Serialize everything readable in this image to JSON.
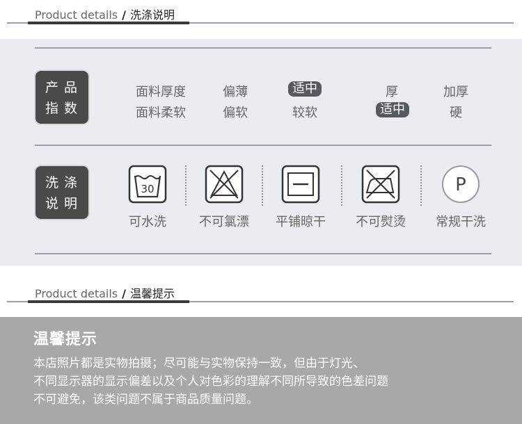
{
  "header1": {
    "en": "Product details",
    "sep": "/",
    "zh": "洗涤说明"
  },
  "header2": {
    "en": "Product details",
    "sep": "/",
    "zh": "温馨提示"
  },
  "product_index": {
    "badge": [
      "产品",
      "指数"
    ],
    "row1": {
      "label": "面料厚度",
      "options": [
        "偏薄",
        "适中",
        "厚",
        "加厚"
      ],
      "selected": "适中"
    },
    "row2": {
      "label": "面料柔软",
      "options": [
        "偏软",
        "较软",
        "适中",
        "硬"
      ],
      "selected": "适中"
    }
  },
  "wash_instructions": {
    "badge": [
      "洗涤",
      "说明"
    ],
    "items": [
      {
        "icon": "wash-30-icon",
        "label": "可水洗",
        "temp": "30"
      },
      {
        "icon": "no-bleach-icon",
        "label": "不可氯漂"
      },
      {
        "icon": "flat-dry-icon",
        "label": "平铺晾干"
      },
      {
        "icon": "no-iron-icon",
        "label": "不可熨烫"
      },
      {
        "icon": "dry-clean-p-icon",
        "label": "常规干洗",
        "letter": "P"
      }
    ]
  },
  "notice": {
    "title": "温馨提示",
    "lines": [
      "本店照片都是实物拍摄；尽可能与实物保持一致，但由于灯光、",
      "不同显示器的显示偏差以及个人对色彩的理解不同所导致的色差问题",
      "不可避免，该类问题不属于商品质量问题。"
    ]
  },
  "colors": {
    "panel": "#eaecf1",
    "badge": "#4a4a4a",
    "selected": "#555a60",
    "notice": "#a8a8a8"
  }
}
